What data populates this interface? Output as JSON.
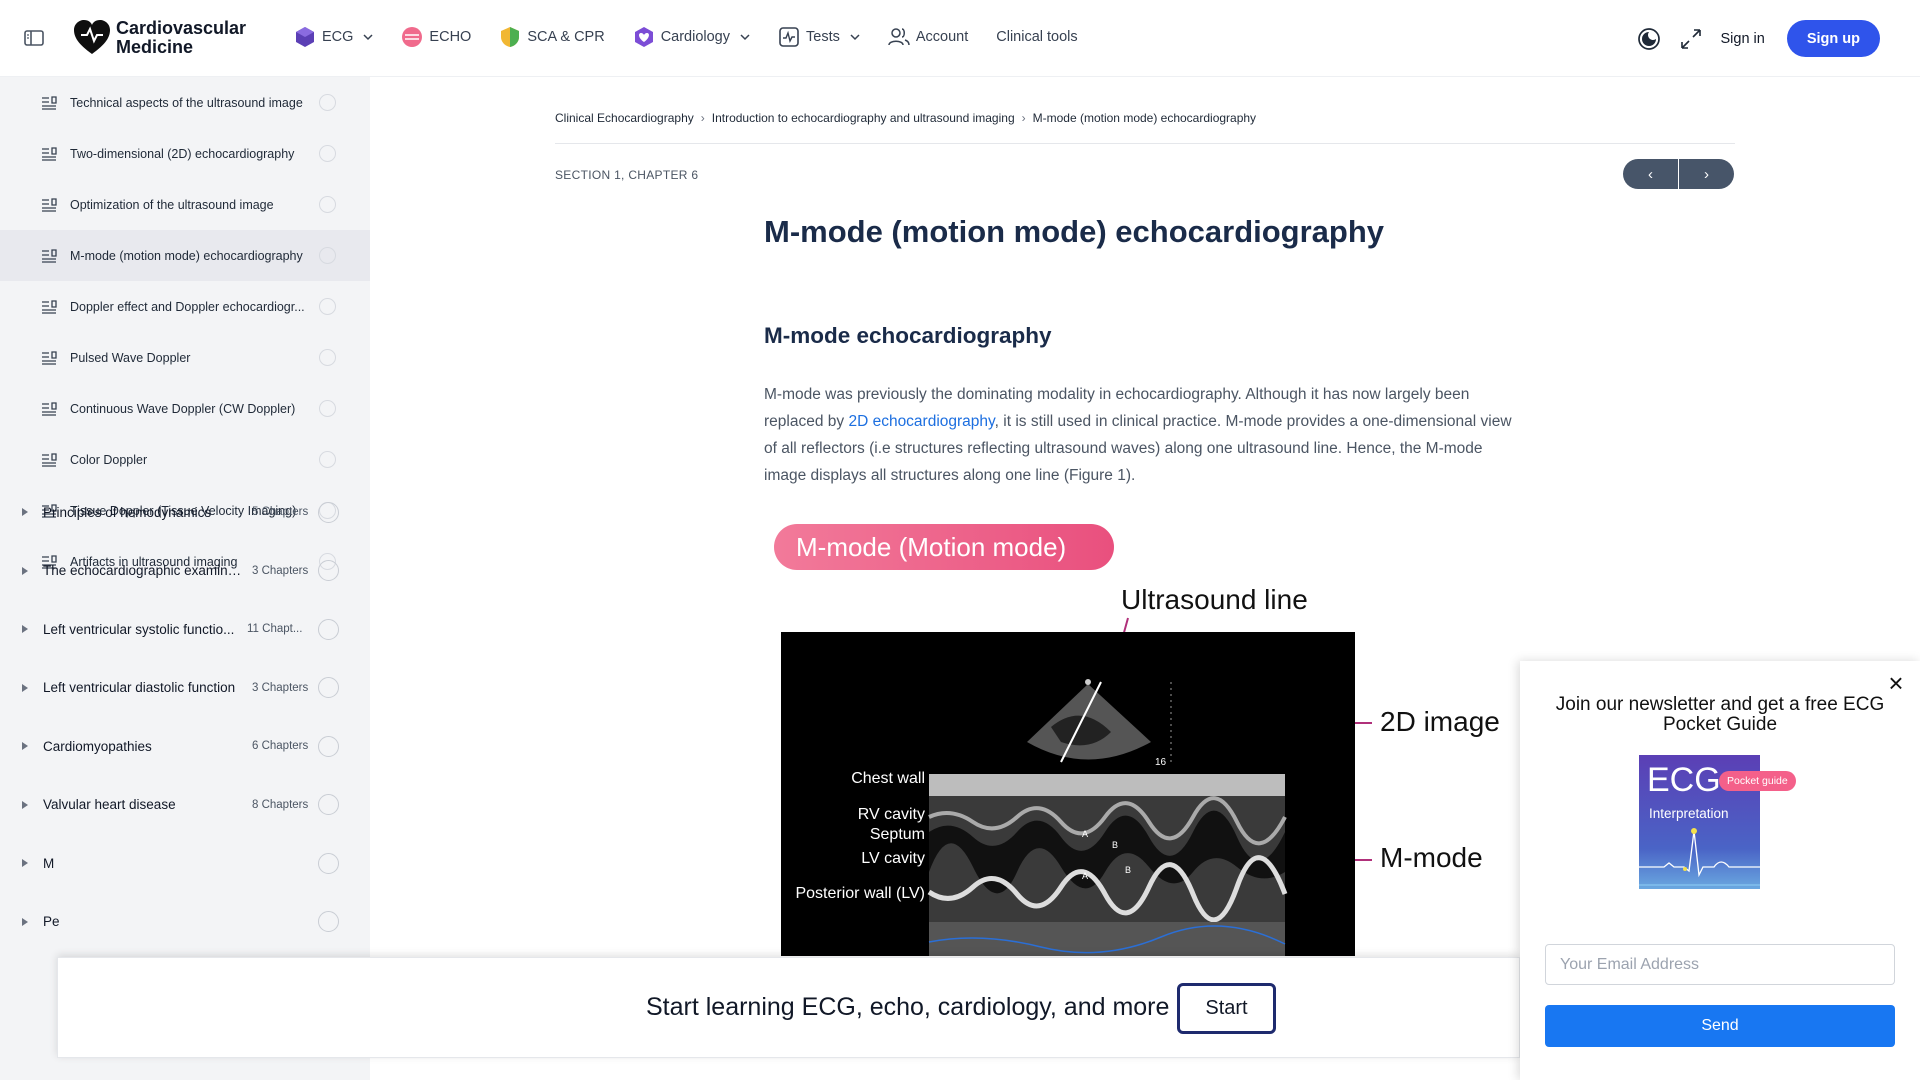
{
  "header": {
    "logo_line1": "Cardiovascular",
    "logo_line2": "Medicine",
    "nav": [
      {
        "label": "ECG",
        "icon": "ecg-gem-icon",
        "has_dropdown": true
      },
      {
        "label": "ECHO",
        "icon": "echo-heart-icon",
        "has_dropdown": false
      },
      {
        "label": "SCA & CPR",
        "icon": "shield-icon",
        "has_dropdown": false
      },
      {
        "label": "Cardiology",
        "icon": "heart-icon",
        "has_dropdown": true
      },
      {
        "label": "Tests",
        "icon": "pulse-square-icon",
        "has_dropdown": true
      },
      {
        "label": "Account",
        "icon": "users-icon",
        "has_dropdown": false
      },
      {
        "label": "Clinical tools",
        "icon": "",
        "has_dropdown": false
      }
    ],
    "sign_in": "Sign in",
    "sign_up": "Sign up",
    "brand_color": "#2f54eb"
  },
  "sidebar": {
    "chapters": [
      {
        "label": "Technical aspects of the ultrasound image",
        "active": false
      },
      {
        "label": "Two-dimensional (2D) echocardiography",
        "active": false
      },
      {
        "label": "Optimization of the ultrasound image",
        "active": false
      },
      {
        "label": "M-mode (motion mode) echocardiography",
        "active": true
      },
      {
        "label": "Doppler effect and Doppler echocardiogr...",
        "active": false
      },
      {
        "label": "Pulsed Wave Doppler",
        "active": false
      },
      {
        "label": "Continuous Wave Doppler (CW Doppler)",
        "active": false
      },
      {
        "label": "Color Doppler",
        "active": false
      },
      {
        "label": "Tissue Doppler (Tissue Velocity Imaging)",
        "active": false
      },
      {
        "label": "Artifacts in ultrasound imaging",
        "active": false
      }
    ],
    "sections": [
      {
        "label": "Principles of hemodynamics",
        "count": "5 Chapters"
      },
      {
        "label": "The echocardiographic examina...",
        "count": "3 Chapters"
      },
      {
        "label": "Left ventricular systolic functio...",
        "count": "11 Chapt..."
      },
      {
        "label": "Left ventricular diastolic function",
        "count": "3 Chapters"
      },
      {
        "label": "Cardiomyopathies",
        "count": "6 Chapters"
      },
      {
        "label": "Valvular heart disease",
        "count": "8 Chapters"
      },
      {
        "label": "M",
        "count": ""
      },
      {
        "label": "Pe",
        "count": ""
      }
    ]
  },
  "main": {
    "breadcrumb": [
      "Clinical Echocardiography",
      "Introduction to echocardiography and ultrasound imaging",
      "M-mode (motion mode) echocardiography"
    ],
    "breadcrumb_sep": "›",
    "section_chapter": "SECTION 1, CHAPTER 6",
    "prev": "‹",
    "next": "›",
    "title": "M-mode (motion mode) echocardiography",
    "subheading": "M-mode echocardiography",
    "para_before_link": "M-mode was previously the dominating modality in echocardiography. Although it has now largely been replaced by ",
    "para_link": "2D echocardiography",
    "para_after_link": ", it is still used in clinical practice. M-mode provides a one-dimensional view of all reflectors (i.e structures reflecting ultrasound waves) along one ultrasound line. Hence, the M-mode image displays all structures along one line (Figure 1).",
    "figure": {
      "pill": "M-mode (Motion mode)",
      "ultrasound_line": "Ultrasound line",
      "image_2d": "2D image",
      "mmode": "M-mode",
      "chest_wall": "Chest wall",
      "rv_cavity": "RV cavity",
      "septum": "Septum",
      "lv_cavity": "LV cavity",
      "posterior_wall": "Posterior wall (LV)",
      "depth_marker": "16",
      "marker_a": "A",
      "marker_b": "B"
    }
  },
  "banner": {
    "text": "Start learning ECG, echo, cardiology, and more",
    "button": "Start"
  },
  "newsletter": {
    "close": "×",
    "title": "Join our newsletter and get a free ECG Pocket Guide",
    "guide_title": "ECG",
    "guide_subtitle": "Interpretation",
    "guide_badge": "Pocket guide",
    "email_placeholder": "Your Email Address",
    "send": "Send"
  }
}
